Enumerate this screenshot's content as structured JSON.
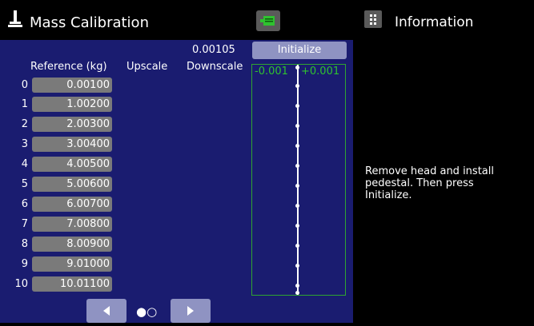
{
  "header": {
    "title": "Mass Calibration",
    "title_icon": "mass-weight-icon",
    "module_icon": "sensor-module-icon",
    "info_icon": "info-dots-icon",
    "info_title": "Information"
  },
  "calibration": {
    "current_value": "0.00105",
    "initialize_label": "Initialize",
    "columns": {
      "reference": "Reference (kg)",
      "upscale": "Upscale",
      "downscale": "Downscale"
    },
    "rows": [
      {
        "index": "0",
        "reference": "0.00100"
      },
      {
        "index": "1",
        "reference": "1.00200"
      },
      {
        "index": "2",
        "reference": "2.00300"
      },
      {
        "index": "3",
        "reference": "3.00400"
      },
      {
        "index": "4",
        "reference": "4.00500"
      },
      {
        "index": "5",
        "reference": "5.00600"
      },
      {
        "index": "6",
        "reference": "6.00700"
      },
      {
        "index": "7",
        "reference": "7.00800"
      },
      {
        "index": "8",
        "reference": "8.00900"
      },
      {
        "index": "9",
        "reference": "9.01000"
      },
      {
        "index": "10",
        "reference": "10.01100"
      }
    ]
  },
  "gauge": {
    "min_label": "-0.001",
    "max_label": "+0.001",
    "color": "#2fa530"
  },
  "pager": {
    "prev_icon": "arrow-left-icon",
    "next_icon": "arrow-right-icon",
    "page_indicator": "●○"
  },
  "info": {
    "message": "Remove head and install\npedestal.  Then press\nInitialize."
  },
  "colors": {
    "panel_bg": "#1a1c70",
    "button_bg": "#8f93c2",
    "ref_button_bg": "#7a7a7a",
    "gauge_green": "#2fc22f"
  }
}
